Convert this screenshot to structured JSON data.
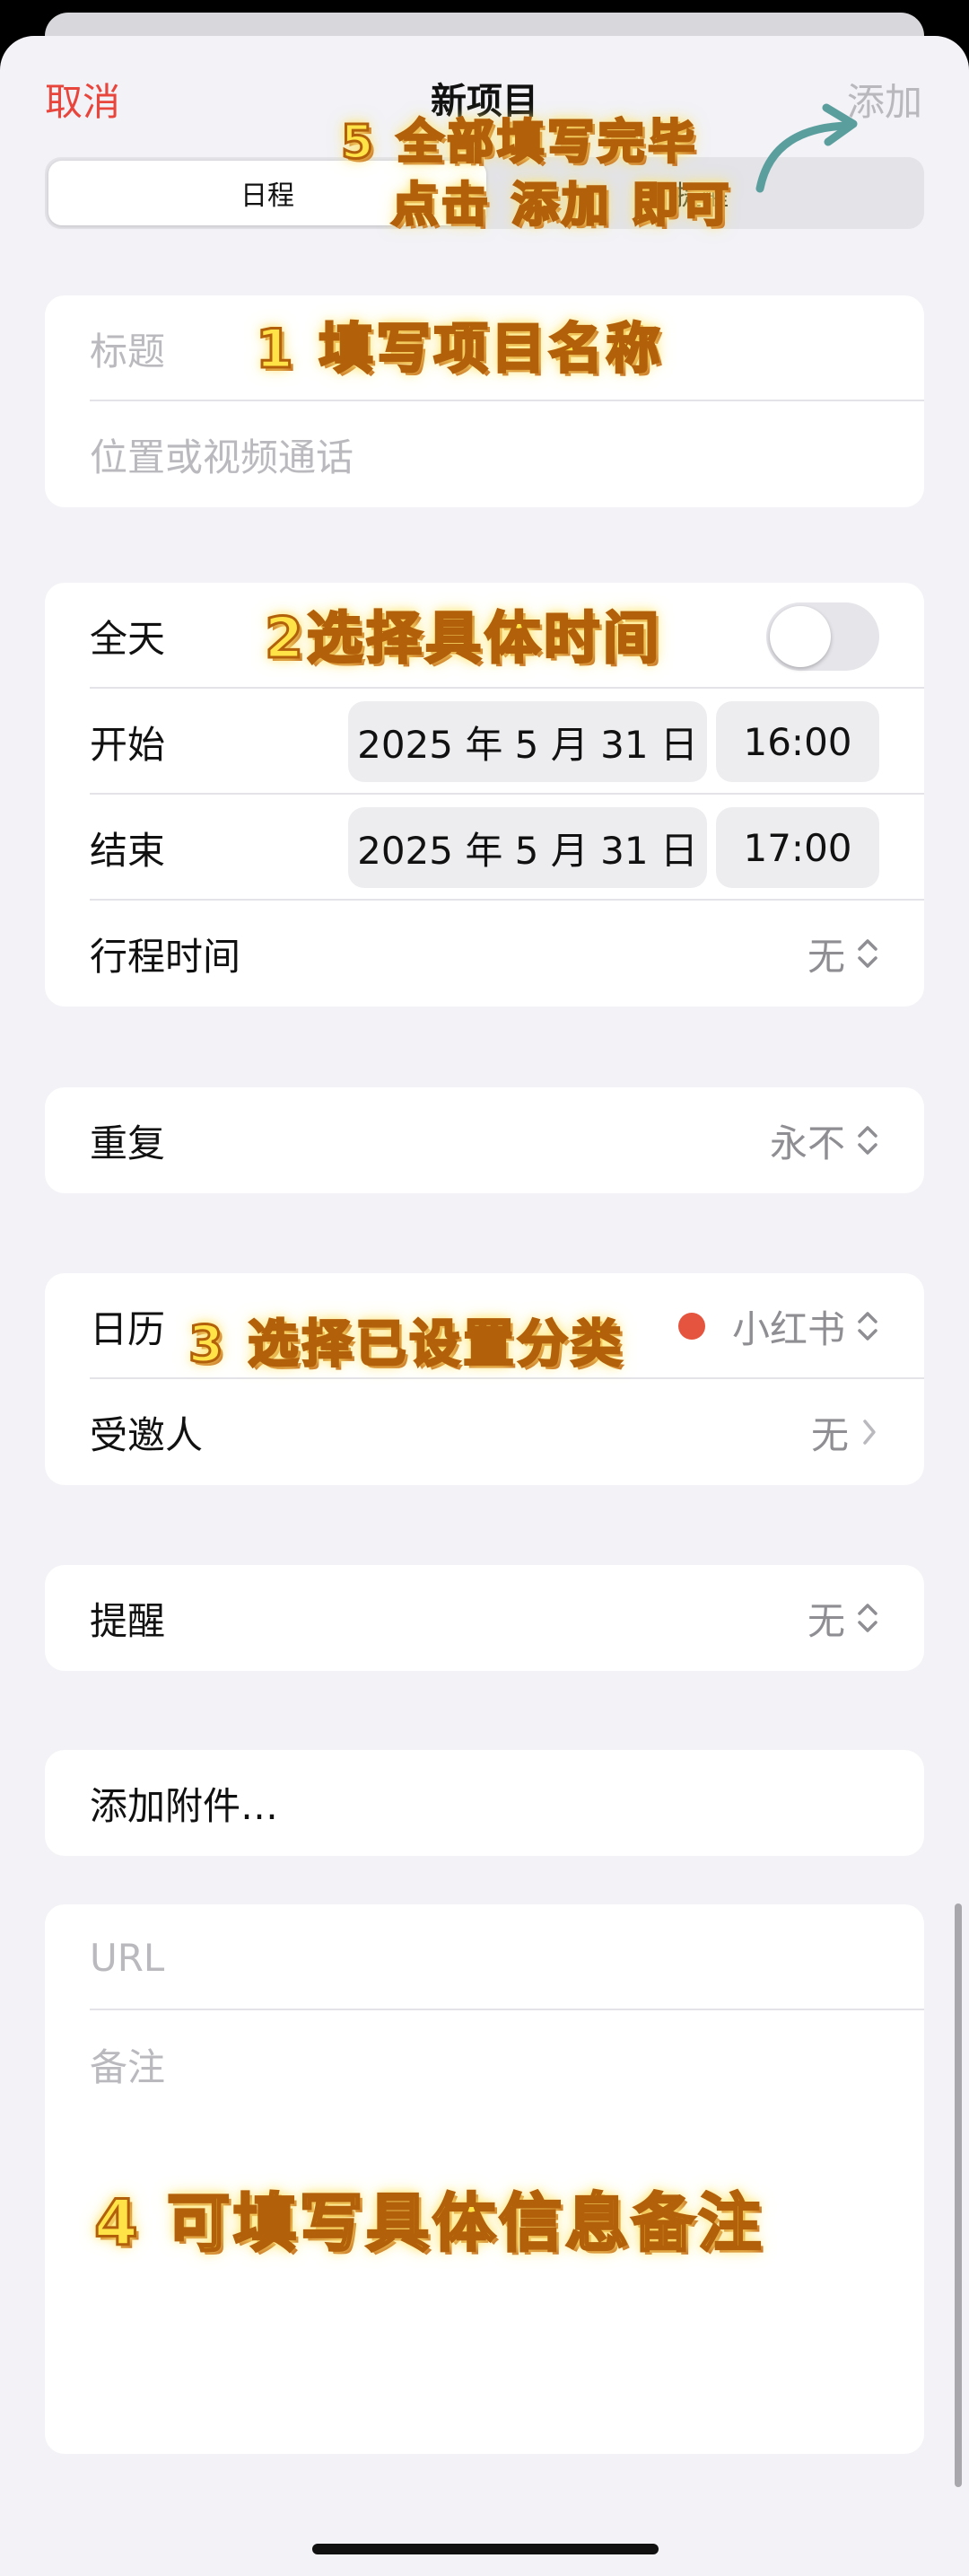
{
  "nav": {
    "cancel": "取消",
    "title": "新项目",
    "add": "添加"
  },
  "segmented": {
    "active": "日程",
    "inactive": "提醒"
  },
  "title_group": {
    "title_placeholder": "标题",
    "location_placeholder": "位置或视频通话"
  },
  "time_group": {
    "all_day": "全天",
    "all_day_on": false,
    "start_label": "开始",
    "start_date": "2025 年 5 月 31 日",
    "start_time": "16:00",
    "end_label": "结束",
    "end_date": "2025 年 5 月 31 日",
    "end_time": "17:00",
    "travel_label": "行程时间",
    "travel_value": "无"
  },
  "repeat_group": {
    "label": "重复",
    "value": "永不"
  },
  "calendar_group": {
    "calendar_label": "日历",
    "calendar_value": "小红书",
    "calendar_color": "#e5543e",
    "invitees_label": "受邀人",
    "invitees_value": "无"
  },
  "alert_group": {
    "label": "提醒",
    "value": "无"
  },
  "attachment_group": {
    "label": "添加附件…"
  },
  "notes_group": {
    "url_placeholder": "URL",
    "notes_placeholder": "备注"
  },
  "annotations": {
    "step1": "1 填写项目名称",
    "step2": "2选择具体时间",
    "step3": "3 选择已设置分类",
    "step4": "4 可填写具体信息备注",
    "step5_line1": "5 全部填写完毕",
    "step5_line2": "点击 添加 即可"
  },
  "colors": {
    "accent": "#e8453c",
    "annotation_fill": "#ffe347",
    "annotation_stroke": "#b3600b",
    "arrow": "#5b9e9e"
  }
}
